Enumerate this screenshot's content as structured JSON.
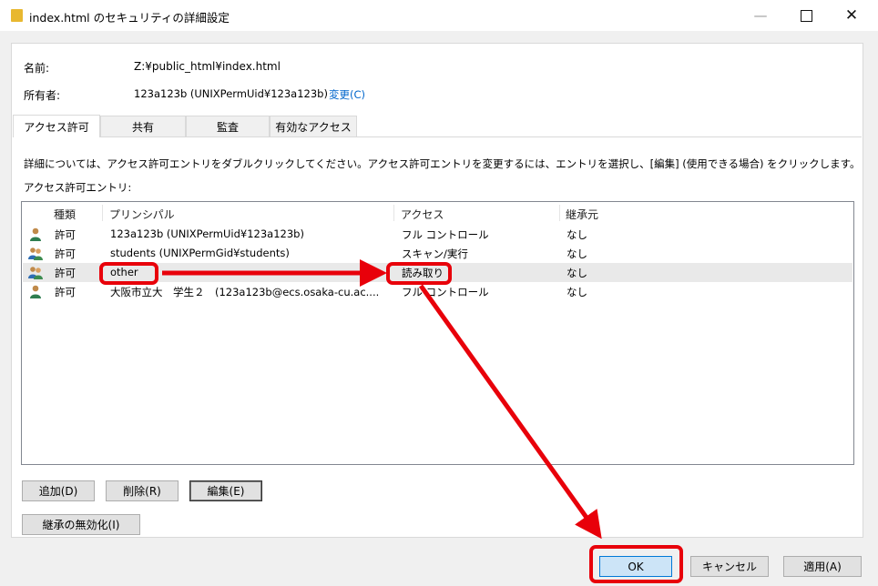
{
  "window": {
    "title": "index.html のセキュリティの詳細設定",
    "icons": [
      "folder-icon",
      "minimize-icon",
      "maximize-icon",
      "close-icon"
    ]
  },
  "info": {
    "name_label": "名前:",
    "name_value": "Z:¥public_html¥index.html",
    "owner_label": "所有者:",
    "owner_value": "123a123b (UNIXPermUid¥123a123b)",
    "change_link": "変更(C)"
  },
  "tabs": [
    {
      "label": "アクセス許可",
      "active": true
    },
    {
      "label": "共有",
      "active": false
    },
    {
      "label": "監査",
      "active": false
    },
    {
      "label": "有効なアクセス",
      "active": false
    }
  ],
  "description": "詳細については、アクセス許可エントリをダブルクリックしてください。アクセス許可エントリを変更するには、エントリを選択し、[編集] (使用できる場合) をクリックします。",
  "entries_label": "アクセス許可エントリ:",
  "table": {
    "headers": [
      "種類",
      "プリンシパル",
      "アクセス",
      "継承元"
    ],
    "rows": [
      {
        "type": "許可",
        "principal": "123a123b (UNIXPermUid¥123a123b)",
        "access": "フル コントロール",
        "inherited": "なし",
        "icon": "user-icon"
      },
      {
        "type": "許可",
        "principal": "students (UNIXPermGid¥students)",
        "access": "スキャン/実行",
        "inherited": "なし",
        "icon": "group-icon"
      },
      {
        "type": "許可",
        "principal": "other",
        "access": "読み取り",
        "inherited": "なし",
        "icon": "group-icon"
      },
      {
        "type": "許可",
        "principal": "大阪市立大　学生２　(123a123b@ecs.osaka-cu.ac....",
        "access": "フル コントロール",
        "inherited": "なし",
        "icon": "user-icon"
      }
    ]
  },
  "buttons": {
    "add": "追加(D)",
    "remove": "削除(R)",
    "edit": "編集(E)",
    "disable_inheritance": "継承の無効化(I)",
    "ok": "OK",
    "cancel": "キャンセル",
    "apply": "適用(A)"
  },
  "colors": {
    "annotation": "#e8000a",
    "link": "#0066cc"
  }
}
